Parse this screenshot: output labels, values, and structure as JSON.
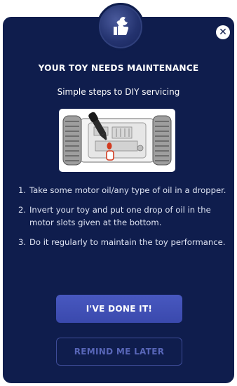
{
  "modal": {
    "title": "YOUR TOY NEEDS MAINTENANCE",
    "subtitle": "Simple steps to DIY servicing",
    "close_glyph": "✕",
    "badge_icon": "thumbs-up-wrench-icon",
    "illustration_icon": "toy-car-oil-dropper-illustration",
    "steps": [
      {
        "num": "1.",
        "text": "Take some motor oil/any type of oil in a dropper."
      },
      {
        "num": "2.",
        "text": "Invert your toy and put one drop of oil in the motor slots given at the bottom."
      },
      {
        "num": "3.",
        "text": "Do it regularly to maintain the toy performance."
      }
    ],
    "primary_button": "I'VE DONE IT!",
    "secondary_button": "REMIND ME LATER"
  },
  "colors": {
    "modal_bg": "#0f1d4d",
    "primary_button": "#4251b6",
    "secondary_border": "#3e4c98",
    "secondary_text": "#5866b8",
    "oil_accent": "#d23a1f"
  }
}
